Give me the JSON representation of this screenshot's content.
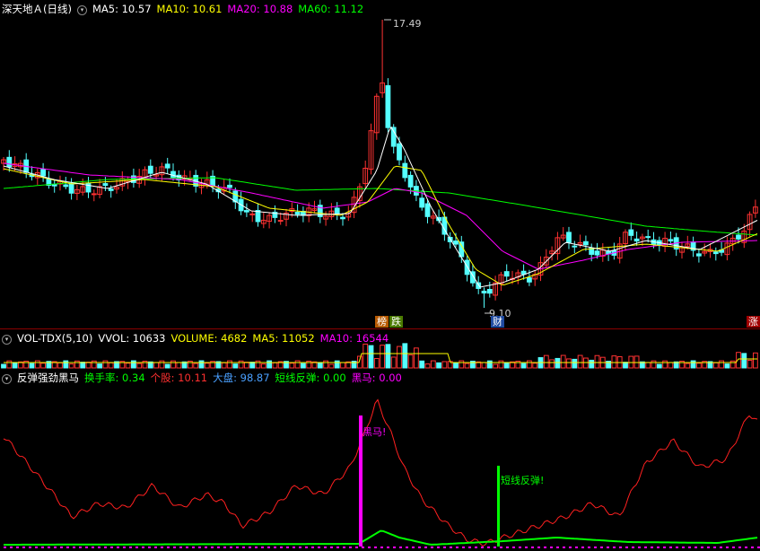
{
  "price": {
    "title": "深天地Ａ(日线)",
    "ma": [
      {
        "label": "MA5: 10.57",
        "color": "#ffffff"
      },
      {
        "label": "MA10: 10.61",
        "color": "#ffff00"
      },
      {
        "label": "MA20: 10.88",
        "color": "#ff00ff"
      },
      {
        "label": "MA60: 11.12",
        "color": "#00ff00"
      }
    ],
    "high_label": "17.49",
    "low_label": "9.10",
    "tags": [
      {
        "text": "榜",
        "bg": "#b85a00",
        "fg": "#ffffff"
      },
      {
        "text": "跌",
        "bg": "#4a7a00",
        "fg": "#ffffff"
      },
      {
        "text": "财",
        "bg": "#1f4aa0",
        "fg": "#ffffff"
      },
      {
        "text": "涨",
        "bg": "#a00000",
        "fg": "#ffffff"
      }
    ]
  },
  "volume": {
    "title": "VOL-TDX(5,10)",
    "items": [
      {
        "label": "VVOL: 10633",
        "color": "#ffffff"
      },
      {
        "label": "VOLUME: 4682",
        "color": "#ffff00"
      },
      {
        "label": "MA5: 11052",
        "color": "#ffff00"
      },
      {
        "label": "MA10: 16544",
        "color": "#ff00ff"
      }
    ]
  },
  "indicator": {
    "title": "反弹强劲黑马",
    "items": [
      {
        "label": "换手率: 0.34",
        "color": "#00ff00"
      },
      {
        "label": "个股: 10.11",
        "color": "#ff3030"
      },
      {
        "label": "大盘: 98.87",
        "color": "#4aa0ff"
      },
      {
        "label": "短线反弹: 0.00",
        "color": "#00ff00"
      },
      {
        "label": "黑马: 0.00",
        "color": "#ff00ff"
      }
    ],
    "signal_heima": "黑马!",
    "signal_fantan": "短线反弹!"
  },
  "colors": {
    "up": "#ff3232",
    "down": "#54ffff",
    "ma5": "#ffffff",
    "ma10": "#ffff00",
    "ma20": "#ff00ff",
    "ma60": "#00ff00",
    "separator": "#8b0000"
  },
  "icons": [
    "circle-toggle-icon"
  ]
}
